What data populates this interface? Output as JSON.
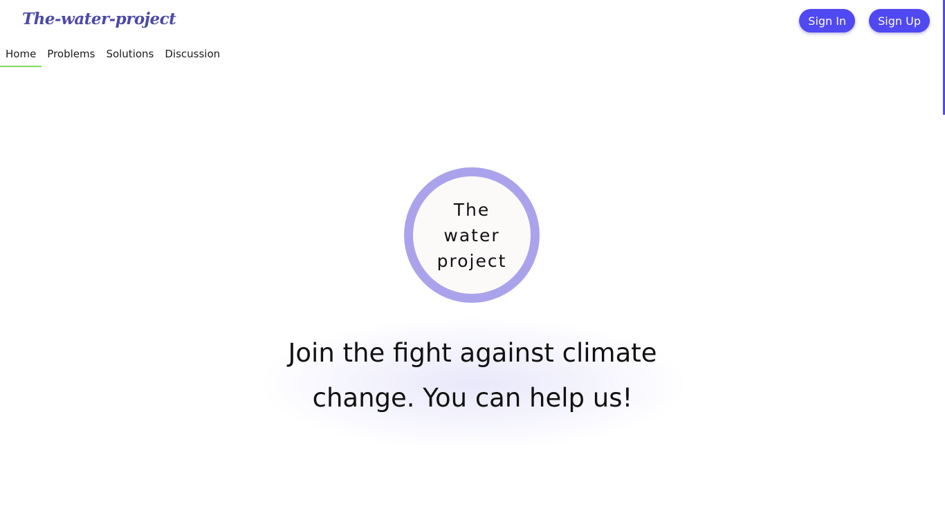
{
  "header": {
    "logo": "The-water-project",
    "sign_in_label": "Sign In",
    "sign_up_label": "Sign Up"
  },
  "nav": {
    "items": [
      {
        "label": "Home",
        "active": true
      },
      {
        "label": "Problems",
        "active": false
      },
      {
        "label": "Solutions",
        "active": false
      },
      {
        "label": "Discussion",
        "active": false
      }
    ]
  },
  "hero": {
    "emblem_lines": [
      "The",
      "water",
      "project"
    ],
    "headline": "Join the fight against climate change. You can help us!"
  },
  "colors": {
    "accent": "#5048f0",
    "logo": "#4b4aa8",
    "emblem_ring": "#aaa3ec",
    "active_tab_underline": "#7ed957"
  }
}
